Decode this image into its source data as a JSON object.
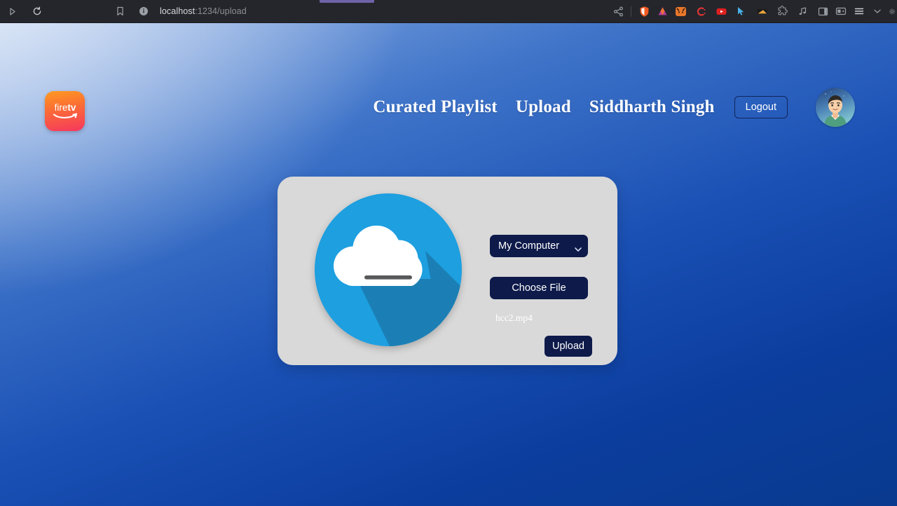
{
  "browser": {
    "url_host": "localhost",
    "url_path": ":1234/upload",
    "nav": {
      "forward_icon": "forward-arrow-icon",
      "reload_icon": "reload-icon",
      "bookmark_icon": "bookmark-icon",
      "site-info_icon": "site-info-icon"
    },
    "right_icons": [
      {
        "name": "share-icon"
      },
      {
        "name": "brave-shields-icon"
      },
      {
        "name": "brave-rewards-icon"
      },
      {
        "name": "extension-fox-icon"
      },
      {
        "name": "extension-c-icon"
      },
      {
        "name": "extension-youtube-icon"
      },
      {
        "name": "extension-cursor-icon"
      },
      {
        "name": "extension-video-icon"
      },
      {
        "name": "extensions-puzzle-icon"
      },
      {
        "name": "music-note-icon"
      },
      {
        "name": "sidebar-panel-icon"
      },
      {
        "name": "wallet-icon"
      },
      {
        "name": "browser-menu-icon"
      },
      {
        "name": "chevron-down-icon"
      },
      {
        "name": "settings-gear-icon"
      }
    ]
  },
  "header": {
    "logo_text_fire": "fire",
    "logo_text_tv": "tv",
    "nav_links": [
      {
        "label": "Curated Playlist"
      },
      {
        "label": "Upload"
      },
      {
        "label": "Siddharth Singh"
      }
    ],
    "logout_label": "Logout",
    "avatar_name": "user-avatar"
  },
  "upload": {
    "cloud_icon": "cloud-upload-icon",
    "source_selected": "My Computer",
    "source_options": [
      "My Computer"
    ],
    "choose_file_label": "Choose File",
    "file_name": "hcc2.mp4",
    "upload_label": "Upload"
  },
  "colors": {
    "card_bg": "#d9d9d9",
    "button_navy": "#0d1a4a",
    "cloud_blue": "#1d9fe0",
    "cloud_shadow": "#1b7fb5",
    "page_blue_deep": "#093a8f",
    "logo_orange": "#ff9a21",
    "logo_pink": "#f6375f"
  }
}
